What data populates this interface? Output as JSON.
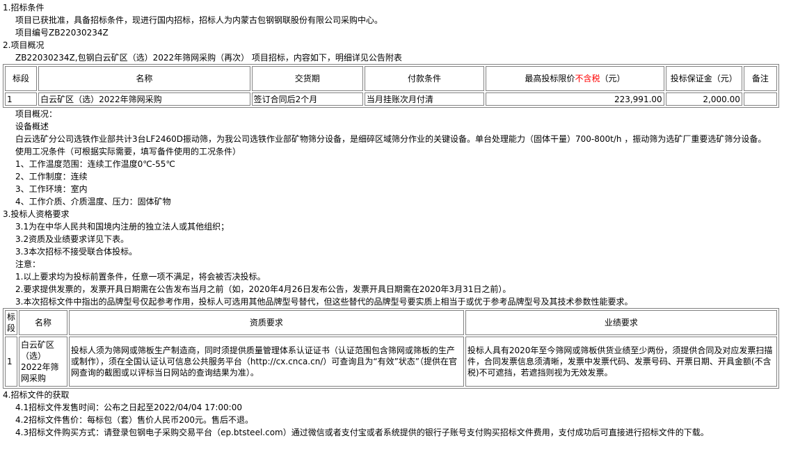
{
  "s1": {
    "title": "1.招标条件",
    "lines": [
      "项目已获批准，具备招标条件，现进行国内招标，招标人为内蒙古包钢钢联股份有限公司采购中心。",
      "项目编号ZB22030234Z"
    ]
  },
  "s2": {
    "title": "2.项目概况",
    "intro": "ZB22030234Z,包钢白云矿区（选）2022年筛网采购（再次） 项目招标，内容如下，明细详见公告附表",
    "table": {
      "h_seg": "标段",
      "h_name": "名称",
      "h_delivery": "交货期",
      "h_payment": "付款条件",
      "h_price_a": "最高投标限价",
      "h_price_red": "不含税",
      "h_price_b": "（元）",
      "h_deposit": "投标保证金（元）",
      "h_remark": "备注",
      "row": {
        "seg": "1",
        "name": "白云矿区（选）2022年筛网采购",
        "delivery": "签订合同后2个月",
        "payment": "当月挂账次月付清",
        "price": "223,991.00",
        "deposit": "2,000.00",
        "remark": ""
      }
    },
    "overview": [
      "项目概况：",
      "设备概述",
      "白云选矿分公司选铁作业部共计3台LF2460D振动筛，为我公司选铁作业部矿物筛分设备，是细碎区域筛分作业的关键设备。单台处理能力（固体干量）700-800t/h ，振动筛为选矿厂重要选矿筛分设备。",
      "使用工况条件（可根据实际需要，填写备件使用的工况条件）",
      "1、工作温度范围：连续工作温度0℃-55℃",
      "2、工作制度：连续",
      "3、工作环境：室内",
      "4、工作介质、介质温度、压力：固体矿物"
    ]
  },
  "s3": {
    "title": "3.投标人资格要求",
    "items": [
      "3.1为在中华人民共和国境内注册的独立法人或其他组织；",
      "3.2资质及业绩要求详见下表。",
      "3.3本次招标不接受联合体投标。"
    ],
    "note_title": "注意：",
    "notes": [
      "1.以上要求均为投标前置条件，任意一项不满足，将会被否决投标。",
      "2.要求提供发票的，发票开具日期需在公告发布当月之前（如，2020年4月26日发布公告，发票开具日期需在2020年3月31日之前）。",
      "3.本次招标文件中指出的品牌型号仅起参考作用，投标人可选用其他品牌型号替代，但这些替代的品牌型号要实质上相当于或优于参考品牌型号及其技术参数性能要求。"
    ],
    "table": {
      "h_seg": "标段",
      "h_name": "名称",
      "h_qual": "资质要求",
      "h_perf": "业绩要求",
      "row": {
        "seg": "1",
        "name": "白云矿区（选）2022年筛网采购",
        "qual": "投标人须为筛网或筛板生产制造商，同时须提供质量管理体系认证证书（认证范围包含筛网或筛板的生产或制作），须在全国认证认可信息公共服务平台（http://cx.cnca.cn/）可查询且为“有效”状态”（提供在官网查询的截图或以评标当日网站的查询结果为准）。",
        "perf": "投标人具有2020年至今筛网或筛板供货业绩至少两份，须提供合同及对应发票扫描件，合同发票信息须清晰，发票中发票代码、发票号码、开票日期、开具金额(不含税)不可遮挡，若遮挡则视为无效发票。"
      }
    }
  },
  "s4": {
    "title": "4.招标文件的获取",
    "items": [
      "4.1招标文件发售时间：公布之日起至2022/04/04 17:00:00",
      "4.2招标文件售价：每标包（套）售价人民币200元。售后不退。",
      "4.3招标文件购买方式：请登录包钢电子采购交易平台（ep.btsteel.com）通过微信或者支付宝或者系统提供的银行子账号支付购买招标文件费用，支付成功后可直接进行招标文件的下载。"
    ]
  },
  "colors": {
    "highlight": "#ff0000",
    "border": "#808080"
  }
}
